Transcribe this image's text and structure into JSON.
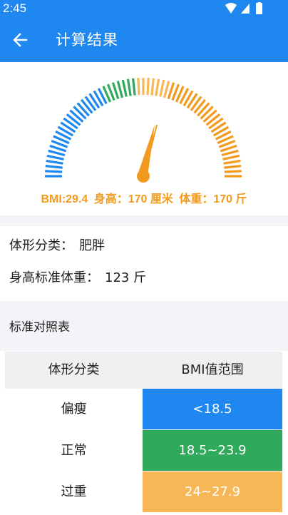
{
  "status": {
    "time": "2:45"
  },
  "appbar": {
    "title": "计算结果",
    "back_icon": "arrow-left-icon"
  },
  "gauge": {
    "bmi_text": "BMI:29.4",
    "height_text": "身高：170 厘米",
    "weight_text": "体重：170 斤",
    "colors": {
      "low": "#1e88f0",
      "normal": "#2eaa5a",
      "high": "#f7b757",
      "obese": "#f29a1d"
    }
  },
  "info": {
    "category_label": "体形分类：",
    "category_value": "肥胖",
    "standard_label": "身高标准体重：",
    "standard_value": "123 斤"
  },
  "reference": {
    "title": "标准对照表",
    "headers": [
      "体形分类",
      "BMI值范围"
    ],
    "rows": [
      {
        "category": "偏瘦",
        "range": "<18.5",
        "color": "#1e88f0"
      },
      {
        "category": "正常",
        "range": "18.5~23.9",
        "color": "#2eaa5a"
      },
      {
        "category": "过重",
        "range": "24~27.9",
        "color": "#f7b757"
      }
    ]
  }
}
